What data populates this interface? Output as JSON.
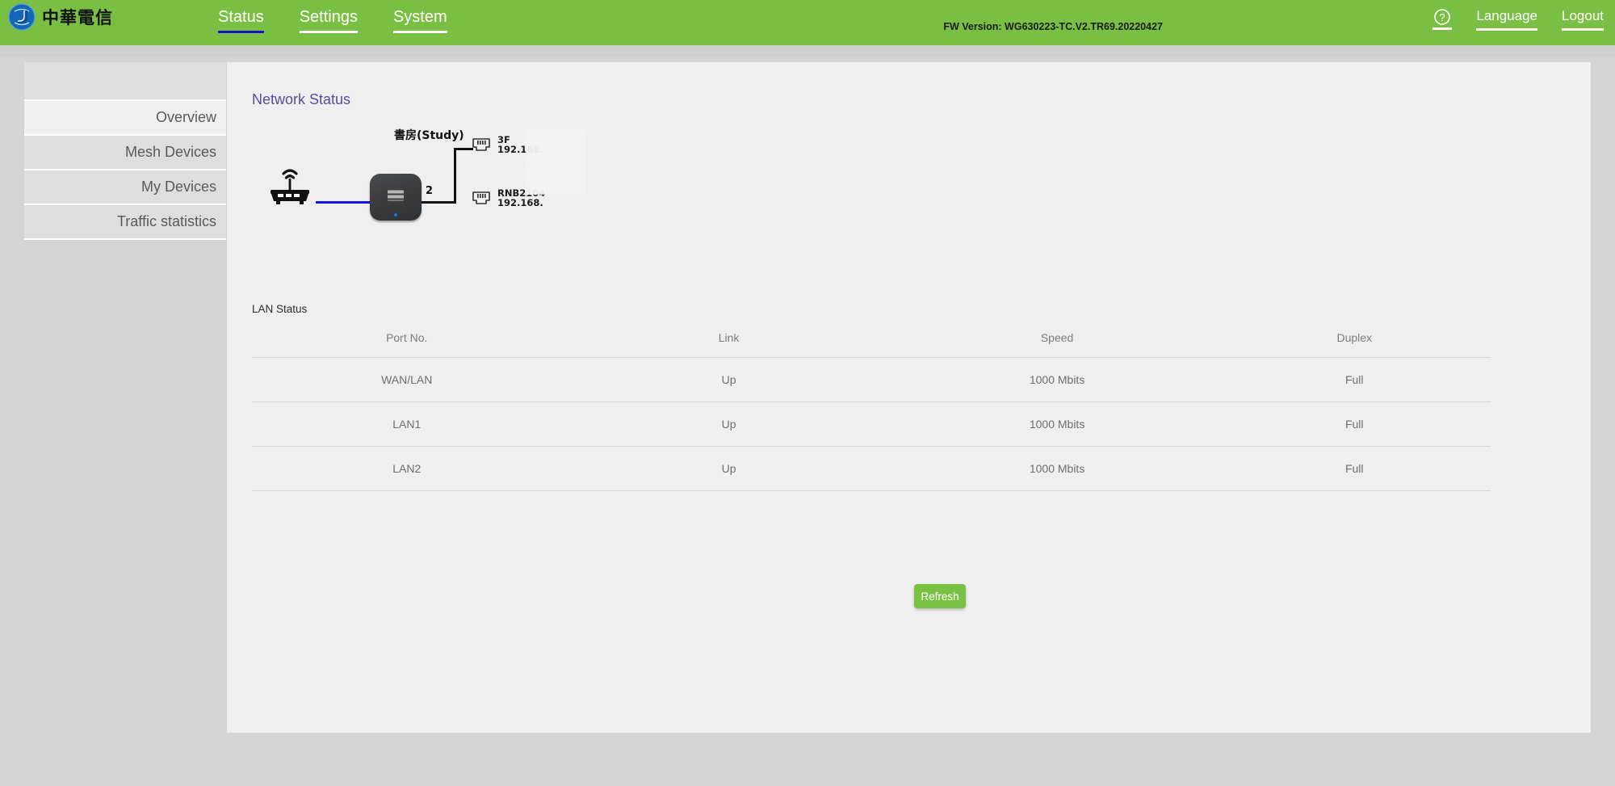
{
  "header": {
    "brand_name": "中華電信",
    "logo_icon": "chunghwa-telecom-globe-logo",
    "nav": [
      {
        "label": "Status",
        "active": true
      },
      {
        "label": "Settings",
        "active": false
      },
      {
        "label": "System",
        "active": false
      }
    ],
    "fw_version": "FW Version: WG630223-TC.V2.TR69.20220427",
    "help_icon": "question-mark-circle-icon",
    "language_label": "Language",
    "logout_label": "Logout"
  },
  "sidebar": {
    "items": [
      {
        "label": "Overview",
        "active": true
      },
      {
        "label": "Mesh Devices",
        "active": false
      },
      {
        "label": "My Devices",
        "active": false
      },
      {
        "label": "Traffic statistics",
        "active": false
      }
    ]
  },
  "main": {
    "section_title": "Network Status",
    "topology": {
      "gateway_icon": "wireless-router-icon",
      "mesh_device_label": "書房(Study)",
      "mesh_device_icon": "mesh-access-point-icon",
      "port_count": "2",
      "clients": [
        {
          "icon": "ethernet-rj45-jack-icon",
          "name": "3F",
          "ip": "192.168."
        },
        {
          "icon": "ethernet-rj45-jack-icon",
          "name": "RNB2104",
          "ip": "192.168."
        }
      ]
    },
    "lan_status": {
      "title": "LAN Status",
      "columns": [
        "Port No.",
        "Link",
        "Speed",
        "Duplex"
      ],
      "rows": [
        {
          "port": "WAN/LAN",
          "link": "Up",
          "speed": "1000 Mbits",
          "duplex": "Full"
        },
        {
          "port": "LAN1",
          "link": "Up",
          "speed": "1000 Mbits",
          "duplex": "Full"
        },
        {
          "port": "LAN2",
          "link": "Up",
          "speed": "1000 Mbits",
          "duplex": "Full"
        }
      ]
    },
    "refresh_label": "Refresh"
  },
  "scrollbar": {
    "left_arrow_icon": "triangle-left-icon",
    "right_arrow_icon": "triangle-right-icon"
  },
  "colors": {
    "brand_green": "#79bf43",
    "button_green": "#79c142",
    "active_tab_underline": "#1414c8",
    "section_title": "#5a4a9e",
    "link_blue": "#1414e6"
  }
}
